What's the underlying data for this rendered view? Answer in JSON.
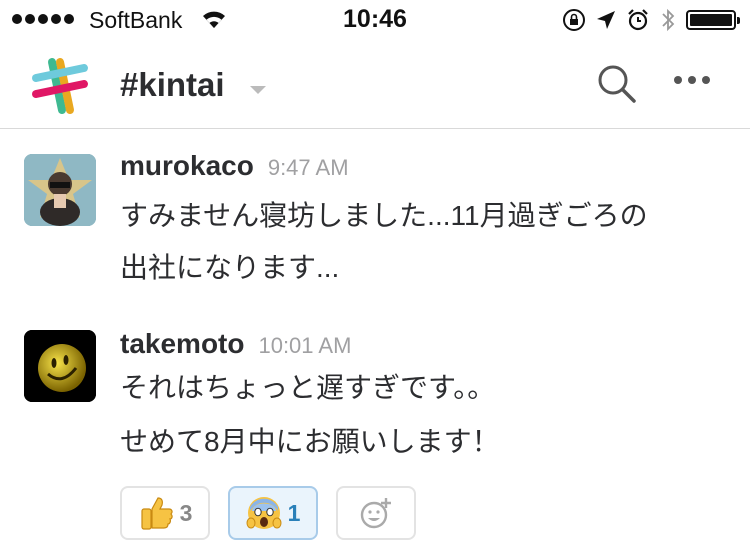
{
  "status_bar": {
    "carrier": "SoftBank",
    "time": "10:46"
  },
  "header": {
    "channel": "#kintai",
    "icons": [
      "slack-logo",
      "chevron-down-icon",
      "search-icon",
      "more-icon"
    ]
  },
  "messages": [
    {
      "author": "murokaco",
      "time": "9:47 AM",
      "lines": [
        "すみません寝坊しました...11月過ぎごろの",
        "出社になります..."
      ]
    },
    {
      "author": "takemoto",
      "time": "10:01 AM",
      "lines": [
        "それはちょっと遅すぎです。。",
        "せめて8月中にお願いします！"
      ]
    }
  ],
  "reactions": [
    {
      "emoji": "thumbs-up",
      "count": "3"
    },
    {
      "emoji": "scream",
      "count": "1",
      "active": true
    },
    {
      "emoji": "add-reaction",
      "count": ""
    }
  ],
  "colors": {
    "accent_blue": "#2a80b9",
    "active_reaction_bg": "#eaf4fc"
  }
}
